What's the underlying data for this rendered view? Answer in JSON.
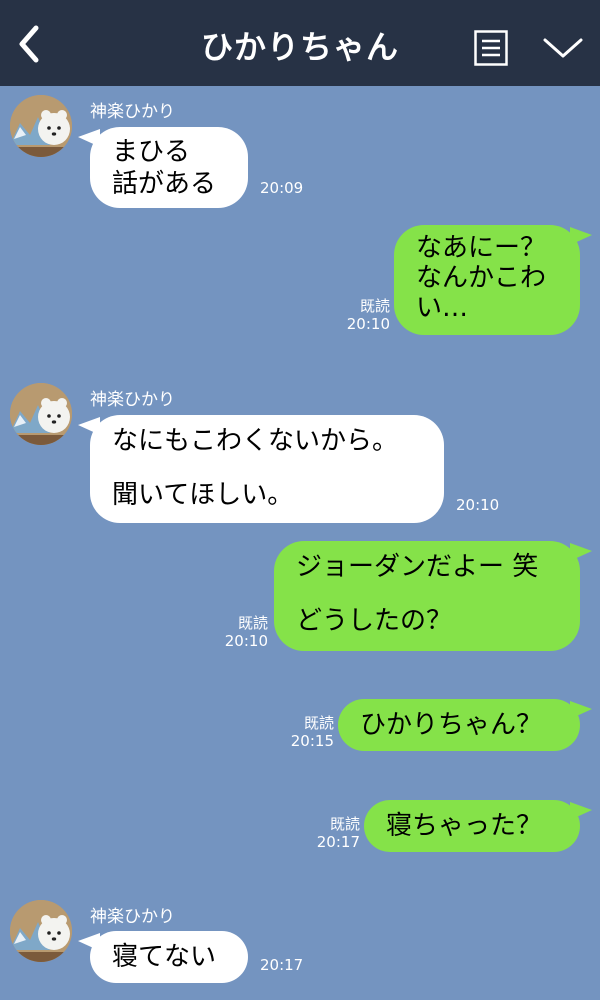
{
  "header": {
    "title": "ひかりちゃん",
    "back_icon": "chevron-left-icon",
    "menu_icon": "notes-icon",
    "collapse_icon": "chevron-down-icon"
  },
  "messages": [
    {
      "sender": "神楽ひかり",
      "lines": [
        "まひる",
        "話がある"
      ],
      "time": "20:09"
    },
    {
      "lines": [
        "なあにー？",
        "なんかこわ",
        "い…"
      ],
      "read": "既読",
      "time": "20:10"
    },
    {
      "sender": "神楽ひかり",
      "lines": [
        "なにもこわくないから。",
        "聞いてほしい。"
      ],
      "time": "20:10"
    },
    {
      "lines": [
        "ジョーダンだよー 笑",
        "どうしたの？"
      ],
      "read": "既読",
      "time": "20:10"
    },
    {
      "lines": [
        "ひかりちゃん？"
      ],
      "read": "既読",
      "time": "20:15"
    },
    {
      "lines": [
        "寝ちゃった？"
      ],
      "read": "既読",
      "time": "20:17"
    },
    {
      "sender": "神楽ひかり",
      "lines": [
        "寝てない"
      ],
      "time": "20:17"
    }
  ],
  "colors": {
    "background": "#7494c0",
    "header": "#273245",
    "outgoing_bubble": "#85e249",
    "incoming_bubble": "#ffffff"
  }
}
